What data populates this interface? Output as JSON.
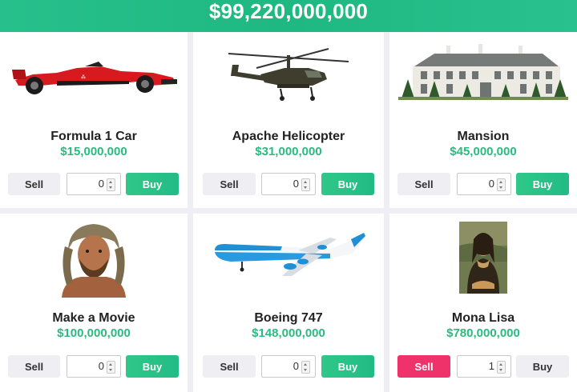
{
  "header": {
    "money": "$99,220,000,000"
  },
  "colors": {
    "accent_green": "#2abb7f",
    "sell_active": "#f0326b",
    "card_bg": "#ffffff",
    "page_bg": "#eeeef3"
  },
  "items": [
    {
      "name": "Formula 1 Car",
      "price": "$15,000,000",
      "qty": "0",
      "sell_label": "Sell",
      "buy_label": "Buy",
      "icon": "f1-car-icon"
    },
    {
      "name": "Apache Helicopter",
      "price": "$31,000,000",
      "qty": "0",
      "sell_label": "Sell",
      "buy_label": "Buy",
      "icon": "helicopter-icon"
    },
    {
      "name": "Mansion",
      "price": "$45,000,000",
      "qty": "0",
      "sell_label": "Sell",
      "buy_label": "Buy",
      "icon": "mansion-icon"
    },
    {
      "name": "Make a Movie",
      "price": "$100,000,000",
      "qty": "0",
      "sell_label": "Sell",
      "buy_label": "Buy",
      "icon": "movie-actor-icon"
    },
    {
      "name": "Boeing 747",
      "price": "$148,000,000",
      "qty": "0",
      "sell_label": "Sell",
      "buy_label": "Buy",
      "icon": "airplane-icon"
    },
    {
      "name": "Mona Lisa",
      "price": "$780,000,000",
      "qty": "1",
      "sell_label": "Sell",
      "buy_label": "Buy",
      "icon": "painting-icon"
    }
  ]
}
